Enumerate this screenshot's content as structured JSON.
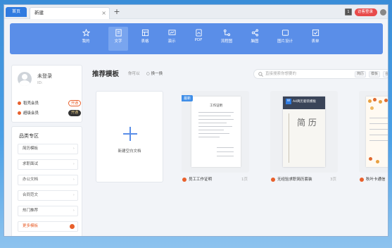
{
  "tabs": {
    "home": "首页",
    "new_tab": "新建",
    "close": "×",
    "add": "+"
  },
  "titlebar": {
    "square_label": "1",
    "user_pill": "访客登录"
  },
  "toolbar": {
    "items": [
      {
        "label": "我的",
        "icon": "star-icon"
      },
      {
        "label": "文字",
        "icon": "document-icon",
        "active": true
      },
      {
        "label": "表格",
        "icon": "table-icon"
      },
      {
        "label": "演示",
        "icon": "presentation-icon"
      },
      {
        "label": "PDF",
        "icon": "pdf-icon"
      },
      {
        "label": "流程图",
        "icon": "flowchart-icon"
      },
      {
        "label": "脑图",
        "icon": "mindmap-icon"
      },
      {
        "label": "图片设计",
        "icon": "image-design-icon"
      },
      {
        "label": "表单",
        "icon": "form-icon"
      }
    ]
  },
  "profile": {
    "name": "未登录",
    "id": "ID:",
    "members": [
      {
        "label": "稻壳会员",
        "button": "开通",
        "color": "#e8602c"
      },
      {
        "label": "超级会员",
        "button": "开通",
        "color": "#333333"
      }
    ]
  },
  "category": {
    "title": "品类专区",
    "items": [
      "简历模板",
      "求职面试",
      "办公文档",
      "合同范文",
      "热门推荐"
    ],
    "more": "更多模板"
  },
  "main": {
    "title": "推荐模板",
    "like": "你可以",
    "refresh": "换一换",
    "search_placeholder": "直接搜索你想要的",
    "chips": [
      "简历",
      "模板",
      "合"
    ],
    "blank_label": "新建空白文档"
  },
  "templates": [
    {
      "name": "员工工作证明",
      "pages": "1页",
      "badge": "最新",
      "doc_title": "工作证明"
    },
    {
      "name": "无经验求职简历套装",
      "pages": "3页",
      "header": "A4简历套装模板",
      "cover_title": "简 历"
    },
    {
      "name": "秋叶卡通信",
      "pages": ""
    }
  ]
}
